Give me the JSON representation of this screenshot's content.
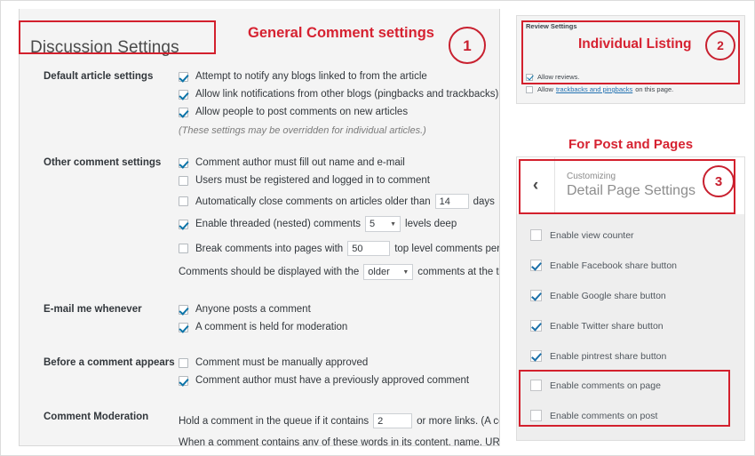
{
  "annotations": {
    "general_label": "General Comment settings",
    "individual_label": "Individual Listing",
    "post_pages_label": "For Post and Pages",
    "marker_1": "1",
    "marker_2": "2",
    "marker_3": "3",
    "accent_color": "#d62231",
    "box_color": "#d3202d"
  },
  "discussion": {
    "page_title": "Discussion Settings",
    "sections": [
      {
        "label": "Default article settings",
        "options": [
          {
            "text": "Attempt to notify any blogs linked to from the article",
            "checked": true
          },
          {
            "text": "Allow link notifications from other blogs (pingbacks and trackbacks) on new articles",
            "checked": true
          },
          {
            "text": "Allow people to post comments on new articles",
            "checked": true
          }
        ],
        "note": "(These settings may be overridden for individual articles.)"
      },
      {
        "label": "Other comment settings",
        "options": [
          {
            "text": "Comment author must fill out name and e-mail",
            "checked": true
          },
          {
            "text": "Users must be registered and logged in to comment",
            "checked": false
          },
          {
            "text": "Automatically close comments on articles older than",
            "checked": false,
            "field_value": "14",
            "text_after": "days"
          },
          {
            "text": "Enable threaded (nested) comments",
            "checked": true,
            "select_value": "5",
            "text_after": "levels deep"
          },
          {
            "text": "Break comments into pages with",
            "checked": false,
            "field_value": "50",
            "text_after": "top level comments per page and the"
          }
        ],
        "trailing_text_before": "Comments should be displayed with the",
        "trailing_select_value": "older",
        "trailing_text_after": "comments at the top of each pa"
      },
      {
        "label": "E-mail me whenever",
        "options": [
          {
            "text": "Anyone posts a comment",
            "checked": true
          },
          {
            "text": "A comment is held for moderation",
            "checked": true
          }
        ]
      },
      {
        "label": "Before a comment appears",
        "options": [
          {
            "text": "Comment must be manually approved",
            "checked": false
          },
          {
            "text": "Comment author must have a previously approved comment",
            "checked": true
          }
        ]
      },
      {
        "label": "Comment Moderation",
        "moderation_line_before": "Hold a comment in the queue if it contains",
        "moderation_field_value": "2",
        "moderation_line_after": "or more links. (A common char",
        "moderation_second_line": "When a comment contains any of these words in its content, name, URL, e-mail, or IP"
      }
    ]
  },
  "review_settings": {
    "title": "Review Settings",
    "options": [
      {
        "text": "Allow reviews.",
        "checked": true
      },
      {
        "text_before": "Allow",
        "link": "trackbacks and pingbacks",
        "text_after": "on this page.",
        "checked": false
      }
    ]
  },
  "customizer": {
    "back_icon": "chevron-left",
    "subtitle": "Customizing",
    "title": "Detail Page Settings",
    "options": [
      {
        "text": "Enable view counter",
        "checked": false
      },
      {
        "text": "Enable Facebook share button",
        "checked": true
      },
      {
        "text": "Enable Google share button",
        "checked": true
      },
      {
        "text": "Enable Twitter share button",
        "checked": true
      },
      {
        "text": "Enable pintrest share button",
        "checked": true
      },
      {
        "text": "Enable comments on page",
        "checked": false
      },
      {
        "text": "Enable comments on post",
        "checked": false
      }
    ]
  }
}
